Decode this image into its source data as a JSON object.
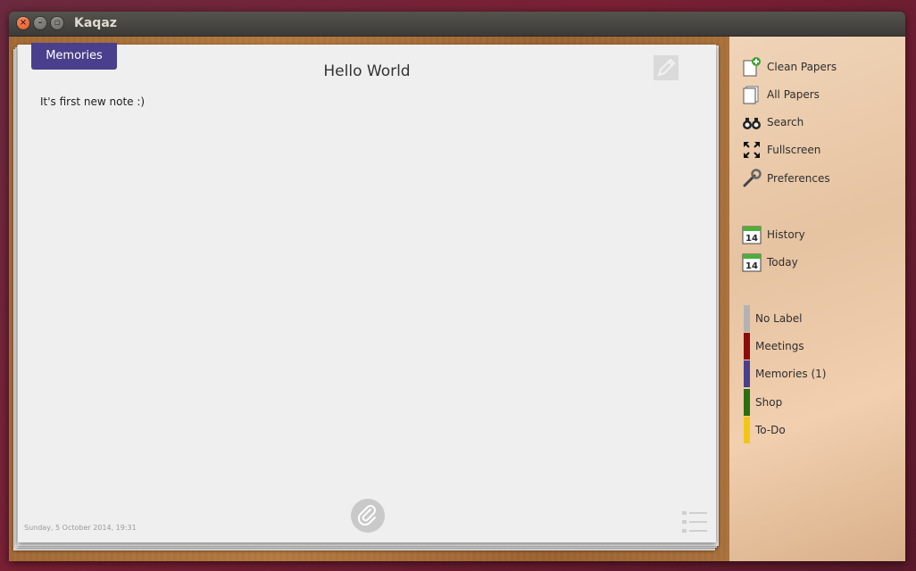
{
  "window": {
    "title": "Kaqaz"
  },
  "paper": {
    "label_tab": "Memories",
    "title": "Hello World",
    "body": "It's first new note :)",
    "date": "Sunday, 5 October 2014, 19:31"
  },
  "sidebar": {
    "menu": [
      {
        "label": "Clean Papers",
        "icon": "clean-papers-icon"
      },
      {
        "label": "All Papers",
        "icon": "all-papers-icon"
      },
      {
        "label": "Search",
        "icon": "binoculars-icon"
      },
      {
        "label": "Fullscreen",
        "icon": "fullscreen-icon"
      },
      {
        "label": "Preferences",
        "icon": "wrench-icon"
      }
    ],
    "dates": [
      {
        "label": "History",
        "day": "14"
      },
      {
        "label": "Today",
        "day": "14"
      }
    ],
    "labels": [
      {
        "label": "No Label",
        "color": "#b3b3b3"
      },
      {
        "label": "Meetings",
        "color": "#8b0c0c"
      },
      {
        "label": "Memories (1)",
        "color": "#4a3f8c"
      },
      {
        "label": "Shop",
        "color": "#2a6e10"
      },
      {
        "label": "To-Do",
        "color": "#f2c615"
      }
    ]
  },
  "colors": {
    "label_tab": "#4a3f8c",
    "titlebar": "#3d3b37"
  }
}
